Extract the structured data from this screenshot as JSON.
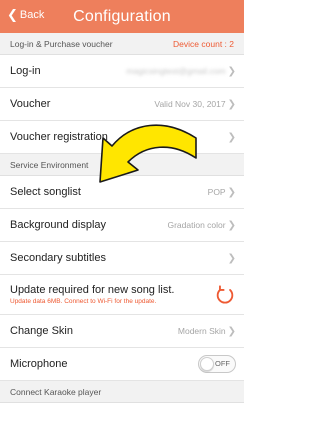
{
  "header": {
    "back_label": "Back",
    "title": "Configuration"
  },
  "sections": {
    "login": {
      "label": "Log-in & Purchase voucher",
      "device_count": "Device count : 2"
    },
    "service": {
      "label": "Service Environment"
    },
    "karaoke": {
      "label": "Connect Karaoke player"
    }
  },
  "rows": {
    "login": {
      "label": "Log-in",
      "value": "magicsingtest@gmail.com"
    },
    "voucher": {
      "label": "Voucher",
      "value": "Valid  Nov 30, 2017"
    },
    "voucher_registration": {
      "label": "Voucher registration"
    },
    "select_songlist": {
      "label": "Select songlist",
      "value": "POP"
    },
    "background_display": {
      "label": "Background display",
      "value": "Gradation color"
    },
    "secondary_subtitles": {
      "label": "Secondary subtitles"
    },
    "update": {
      "label": "Update required for new song list.",
      "sub": "Update data 6MB. Connect to Wi-Fi for the update."
    },
    "change_skin": {
      "label": "Change Skin",
      "value": "Modern Skin"
    },
    "microphone": {
      "label": "Microphone",
      "toggle": "OFF"
    }
  },
  "colors": {
    "accent": "#ee7f5c",
    "alert": "#ee5a33",
    "arrow_fill": "#ffe600"
  },
  "icons": {
    "back": "chevron-left-icon",
    "row_arrow": "chevron-right-icon",
    "refresh": "refresh-icon",
    "pointer": "curved-arrow-icon"
  }
}
